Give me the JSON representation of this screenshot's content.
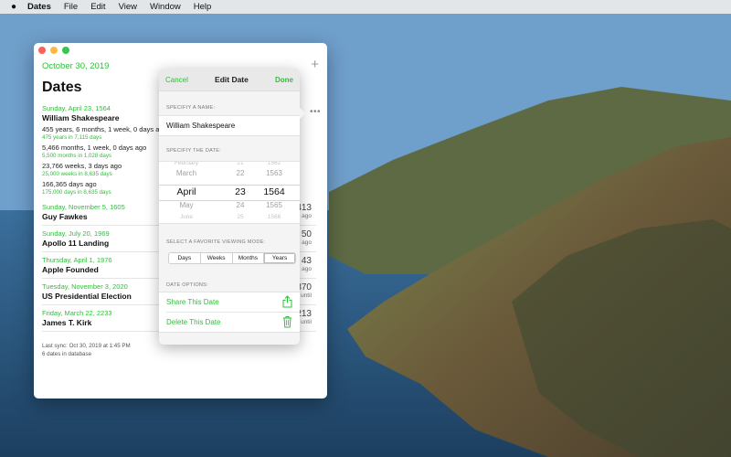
{
  "menubar": {
    "apple_icon": "apple-logo-icon",
    "app_name": "Dates",
    "items": [
      "File",
      "Edit",
      "View",
      "Window",
      "Help"
    ]
  },
  "window": {
    "date_header": "October 30, 2019",
    "title": "Dates",
    "add_icon": "plus-icon",
    "more_icon": "ellipsis-icon",
    "entries": [
      {
        "date": "Sunday, April 23, 1564",
        "name": "William Shakespeare",
        "details": [
          {
            "text": "455 years, 6 months, 1 week, 0 days ago",
            "sub": "475 years in 7,115 days"
          },
          {
            "text": "5,466 months, 1 week, 0 days ago",
            "sub": "5,500 months in 1,028 days"
          },
          {
            "text": "23,766 weeks, 3 days ago",
            "sub": "25,000 weeks in 8,635 days"
          },
          {
            "text": "166,365 days ago",
            "sub": "175,000 days in 8,635 days"
          }
        ]
      },
      {
        "date": "Sunday, November 5, 1605",
        "name": "Guy Fawkes",
        "number": "413",
        "unit": "years ago"
      },
      {
        "date": "Sunday, July 20, 1969",
        "name": "Apollo 11 Landing",
        "number": "50",
        "unit": "years ago"
      },
      {
        "date": "Thursday, April 1, 1976",
        "name": "Apple Founded",
        "number": "43",
        "unit": "years ago"
      },
      {
        "date": "Tuesday, November 3, 2020",
        "name": "US Presidential Election",
        "number": "370",
        "unit": "days until"
      },
      {
        "date": "Friday, March 22, 2233",
        "name": "James T. Kirk",
        "number": "213",
        "unit": "years until"
      }
    ],
    "footer_sync": "Last sync: Oct 30, 2019 at 1:45 PM",
    "footer_count": "6 dates in database"
  },
  "popover": {
    "cancel": "Cancel",
    "title": "Edit Date",
    "done": "Done",
    "name_label": "SPECIFIY A NAME:",
    "name_value": "William Shakespeare",
    "date_label": "SPECIFIY THE DATE:",
    "picker": {
      "months": [
        "February",
        "March",
        "April",
        "May",
        "June"
      ],
      "days": [
        "21",
        "22",
        "23",
        "24",
        "25"
      ],
      "years": [
        "1562",
        "1563",
        "1564",
        "1565",
        "1566"
      ]
    },
    "mode_label": "SELECT A FAVORITE VIEWING MODE:",
    "modes": [
      "Days",
      "Weeks",
      "Months",
      "Years"
    ],
    "selected_mode": "Years",
    "options_label": "DATE OPTIONS:",
    "share_label": "Share This Date",
    "share_icon": "share-icon",
    "delete_label": "Delete This Date",
    "delete_icon": "trash-icon",
    "accent_color": "#2fbf3a"
  }
}
